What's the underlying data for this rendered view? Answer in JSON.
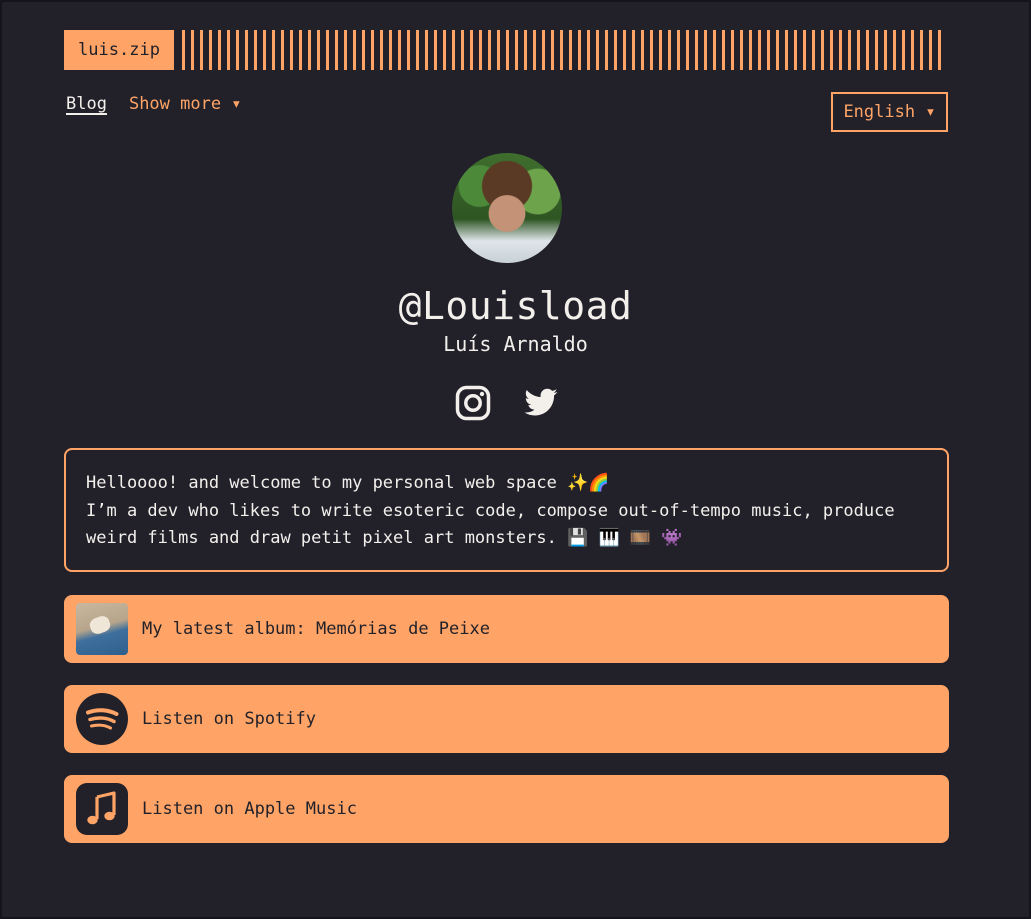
{
  "header": {
    "logo": "luis.zip"
  },
  "nav": {
    "blog": "Blog",
    "show_more": "Show more ▾"
  },
  "language": {
    "selected": "English ▾"
  },
  "profile": {
    "handle": "@Louisload",
    "name": "Luís Arnaldo",
    "socials": [
      "instagram-icon",
      "twitter-icon"
    ]
  },
  "bio": {
    "line1": "Helloooo! and welcome to my personal web space ✨🌈",
    "line2": "I’m a dev who likes to write esoteric code, compose out-of-tempo music, produce",
    "line3": "weird films and draw petit pixel art monsters. 💾 🎹 🎞️ 👾"
  },
  "links": [
    {
      "label": "My latest album: Memórias de Peixe",
      "icon": "album-cover"
    },
    {
      "label": "Listen on Spotify",
      "icon": "spotify-icon"
    },
    {
      "label": "Listen on Apple Music",
      "icon": "apple-music-icon"
    }
  ],
  "colors": {
    "background": "#22212a",
    "accent": "#ffa466",
    "text": "#f3f0ec"
  }
}
